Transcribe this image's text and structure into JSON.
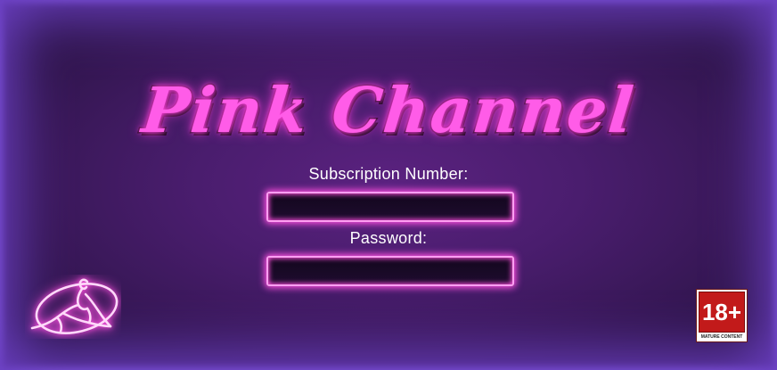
{
  "app": {
    "title": "Pink Channel"
  },
  "login": {
    "subscription_label": "Subscription Number:",
    "subscription_value": "",
    "password_label": "Password:",
    "password_value": ""
  },
  "badge": {
    "age": "18+",
    "caption": "MATURE CONTENT"
  },
  "icons": {
    "logo": "reclining-woman-neon-logo",
    "age_badge": "age-rating-badge"
  },
  "colors": {
    "background": "#4a1d6e",
    "neon_pink": "#ff5ce8",
    "field_glow": "#ff4fe0",
    "border_glow": "#6a3fc0",
    "badge_red": "#c21a1a"
  }
}
